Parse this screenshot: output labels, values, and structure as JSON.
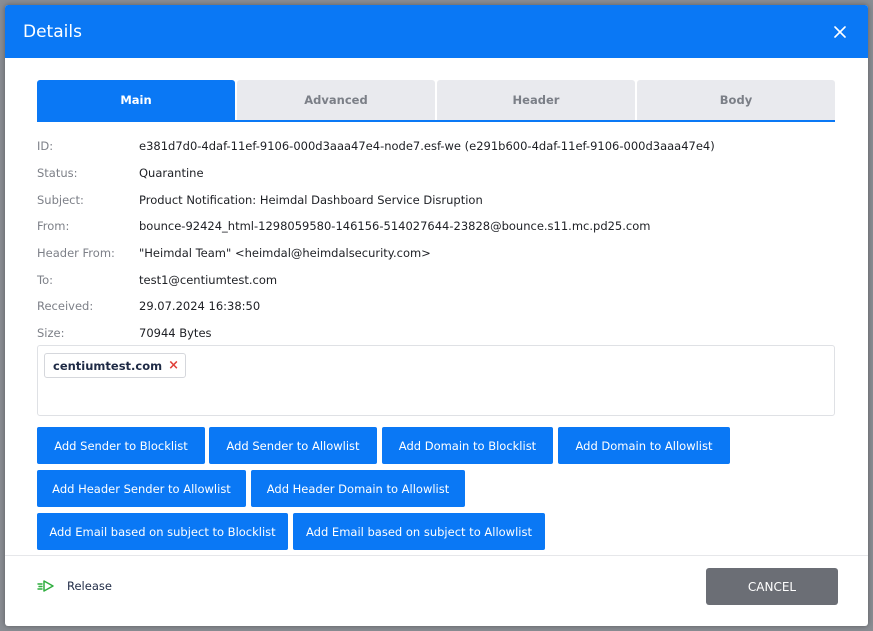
{
  "dialog": {
    "title": "Details"
  },
  "tabs": [
    {
      "label": "Main"
    },
    {
      "label": "Advanced"
    },
    {
      "label": "Header"
    },
    {
      "label": "Body"
    }
  ],
  "details": {
    "id": {
      "label": "ID:",
      "value": "e381d7d0-4daf-11ef-9106-000d3aaa47e4-node7.esf-we (e291b600-4daf-11ef-9106-000d3aaa47e4)"
    },
    "status": {
      "label": "Status:",
      "value": "Quarantine"
    },
    "subject": {
      "label": "Subject:",
      "value": "Product Notification: Heimdal Dashboard Service Disruption"
    },
    "from": {
      "label": "From:",
      "value": "bounce-92424_html-1298059580-146156-514027644-23828@bounce.s11.mc.pd25.com"
    },
    "header_from": {
      "label": "Header From:",
      "value": "\"Heimdal Team\" <heimdal@heimdalsecurity.com>"
    },
    "to": {
      "label": "To:",
      "value": "test1@centiumtest.com"
    },
    "received": {
      "label": "Received:",
      "value": "29.07.2024 16:38:50"
    },
    "size": {
      "label": "Size:",
      "value": "70944 Bytes"
    }
  },
  "tag": {
    "label": "centiumtest.com",
    "remove": "×"
  },
  "actions": {
    "add_sender_blocklist": "Add Sender to Blocklist",
    "add_sender_allowlist": "Add Sender to Allowlist",
    "add_domain_blocklist": "Add Domain to Blocklist",
    "add_domain_allowlist": "Add Domain to Allowlist",
    "add_header_sender_allowlist": "Add Header Sender to Allowlist",
    "add_header_domain_allowlist": "Add Header Domain to Allowlist",
    "add_subject_blocklist": "Add Email based on subject to Blocklist",
    "add_subject_allowlist": "Add Email based on subject to Allowlist"
  },
  "footer": {
    "release_label": "Release",
    "cancel_label": "CANCEL"
  },
  "colors": {
    "primary": "#0a78f5",
    "cancel": "#6b6e75",
    "release_icon": "#2fae3f",
    "tag_remove": "#e0403a"
  }
}
